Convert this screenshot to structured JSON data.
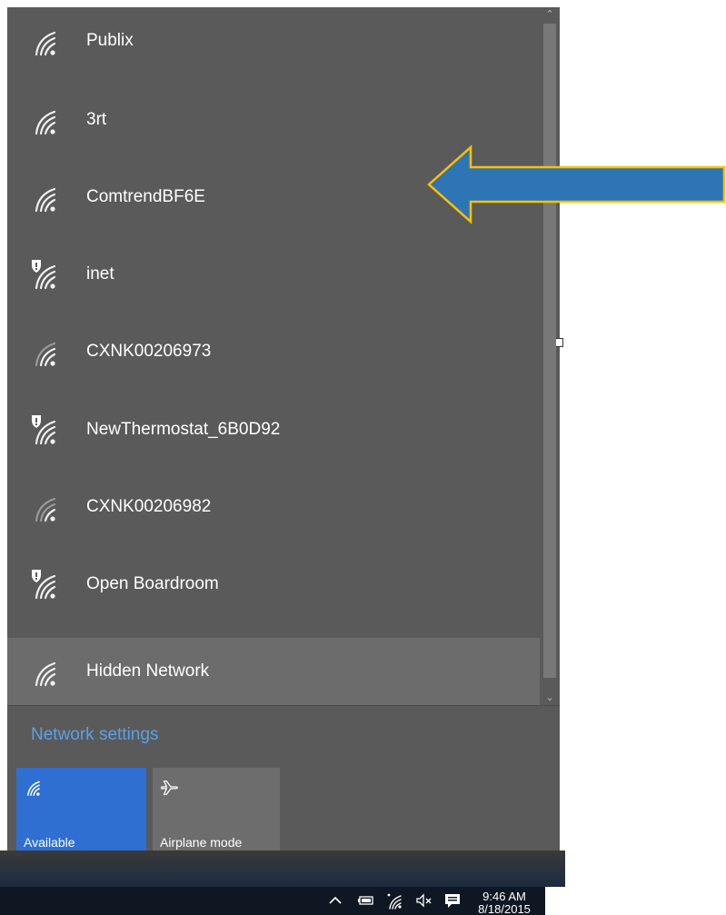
{
  "networks": [
    {
      "name": "Publix",
      "secured": false
    },
    {
      "name": "3rt",
      "secured": false
    },
    {
      "name": "ComtrendBF6E",
      "secured": false
    },
    {
      "name": "inet",
      "secured": true
    },
    {
      "name": "CXNK00206973",
      "secured": false
    },
    {
      "name": "NewThermostat_6B0D92",
      "secured": true
    },
    {
      "name": "CXNK00206982",
      "secured": false
    },
    {
      "name": "Open Boardroom",
      "secured": true
    },
    {
      "name": "Hidden Network",
      "secured": false
    }
  ],
  "settings_link": "Network settings",
  "quick_actions": {
    "wifi_label": "Available",
    "airplane_label": "Airplane mode"
  },
  "taskbar": {
    "time": "9:46 AM",
    "date": "8/18/2015",
    "icons": [
      "chevron-up-icon",
      "battery-icon",
      "wifi-icon",
      "speaker-muted-icon",
      "action-center-icon"
    ]
  },
  "colors": {
    "panel": "#5a5a5a",
    "hover": "#6c6c6c",
    "link": "#5aa0e6",
    "tile_active": "#2f6fd1",
    "tile_inactive": "#6d6d6d",
    "taskbar": "#0f1822",
    "arrow_fill": "#2e75b6",
    "arrow_outline": "#ffc000"
  }
}
